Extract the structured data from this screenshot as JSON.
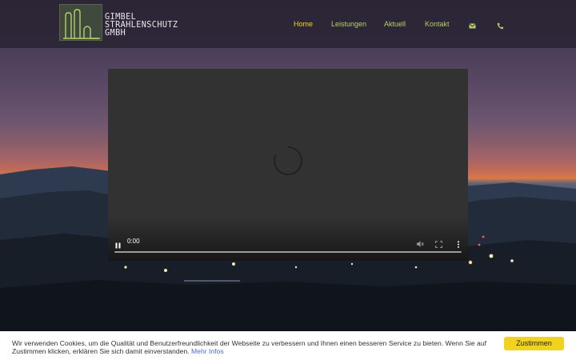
{
  "brand": {
    "line1": "GIMBEL",
    "line2": "STRAHLENSCHUTZ",
    "line3": "GMBH",
    "accent_color": "#b7cf6a"
  },
  "nav": {
    "items": [
      {
        "label": "Home",
        "active": true
      },
      {
        "label": "Leistungen",
        "active": false
      },
      {
        "label": "Aktuell",
        "active": false
      },
      {
        "label": "Kontakt",
        "active": false
      }
    ],
    "email_icon": "envelope-icon",
    "phone_icon": "phone-icon",
    "active_color": "#f2d21c"
  },
  "video": {
    "time": "0:00",
    "state": "loading",
    "icons": [
      "pause-icon",
      "mute-icon",
      "fullscreen-icon",
      "more-options-icon"
    ]
  },
  "cookie": {
    "text": "Wir verwenden Cookies, um die Qualität und Benutzerfreundlichkeit der Webseite zu verbessern und Ihnen einen besseren Service zu bieten. Wenn Sie auf Zustimmen klicken, erklären Sie sich damit einverstanden.",
    "link_label": "Mehr Infos",
    "button_label": "Zustimmen",
    "button_color": "#f2d21c"
  }
}
